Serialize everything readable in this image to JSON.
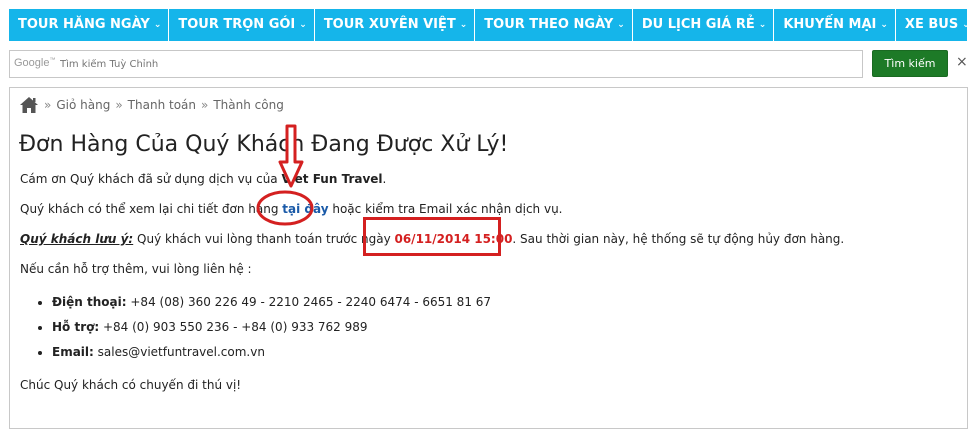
{
  "nav": {
    "items": [
      {
        "label": "TOUR HĂNG NGÀY"
      },
      {
        "label": "TOUR TRỌN GÓI"
      },
      {
        "label": "TOUR XUYÊN VIỆT"
      },
      {
        "label": "TOUR THEO NGÀY"
      },
      {
        "label": "DU LỊCH GIÁ RẺ"
      },
      {
        "label": "KHUYẾN MẠI"
      },
      {
        "label": "XE BUS"
      }
    ],
    "caret": "⌄"
  },
  "search": {
    "logo": "Google",
    "logo_tm": "™",
    "placeholder": "Tìm kiếm Tuỳ Chỉnh",
    "button": "Tìm kiếm",
    "clear": "×"
  },
  "breadcrumb": {
    "sep": "»",
    "items": [
      "Giỏ hàng",
      "Thanh toán",
      "Thành công"
    ]
  },
  "page": {
    "title": "Đơn Hàng Của Quý Khách Đang Được Xử Lý!",
    "thanks_prefix": "Cám ơn Quý khách đã sử dụng dịch vụ của ",
    "brand": "Viet Fun Travel",
    "thanks_suffix": ".",
    "review_prefix": "Quý khách có thể xem lại chi tiết đơn hàng ",
    "review_link": "tại đây",
    "review_suffix": " hoặc kiểm tra Email xác nhận dịch vụ.",
    "note_label": "Quý khách lưu ý:",
    "note_prefix": " Quý khách vui lòng thanh toán trước ngày ",
    "deadline": "06/11/2014 15:00",
    "note_suffix": ". Sau thời gian này, hệ thống sẽ tự động hủy đơn hàng.",
    "support": "Nếu cần hỗ trợ thêm, vui lòng liên hệ :",
    "contacts": [
      {
        "label": "Điện thoại:",
        "value": " +84 (08) 360 226 49 - 2210 2465 - 2240 6474 - 6651 81 67"
      },
      {
        "label": "Hỗ trợ:",
        "value": " +84 (0) 903 550 236 - +84 (0) 933 762 989"
      },
      {
        "label": "Email:",
        "value": " sales@vietfuntravel.com.vn"
      }
    ],
    "closing": "Chúc Quý khách có chuyến đi thú vị!"
  },
  "colors": {
    "nav": "#15b5ea",
    "button": "#1d7a27",
    "annotation": "#d42020",
    "link": "#1a5aa8"
  }
}
